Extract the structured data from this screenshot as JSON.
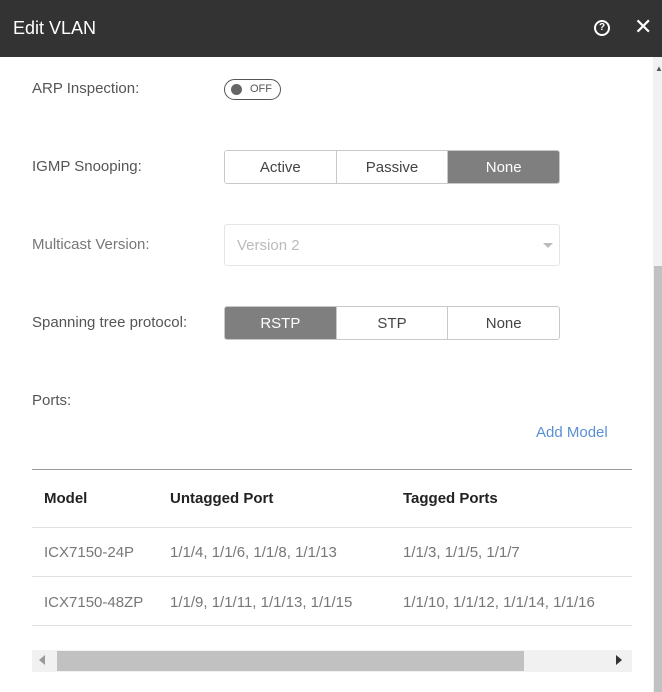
{
  "header": {
    "title": "Edit VLAN",
    "help_icon": "help-circle-icon",
    "help_glyph": "?",
    "close_icon": "close-icon",
    "close_glyph": "✕"
  },
  "form": {
    "arp_label": "ARP Inspection:",
    "arp_toggle_text": "OFF",
    "igmp_label": "IGMP Snooping:",
    "igmp_options": [
      "Active",
      "Passive",
      "None"
    ],
    "igmp_selected": "None",
    "multicast_label": "Multicast Version:",
    "multicast_value": "Version 2",
    "stp_label": "Spanning tree protocol:",
    "stp_options": [
      "RSTP",
      "STP",
      "None"
    ],
    "stp_selected": "RSTP",
    "ports_label": "Ports:",
    "add_model_label": "Add Model"
  },
  "table": {
    "headers": [
      "Model",
      "Untagged Port",
      "Tagged Ports"
    ],
    "rows": [
      [
        "ICX7150-24P",
        "1/1/4, 1/1/6, 1/1/8, 1/1/13",
        "1/1/3, 1/1/5, 1/1/7"
      ],
      [
        "ICX7150-48ZP",
        "1/1/9, 1/1/11, 1/1/13, 1/1/15",
        "1/1/10, 1/1/12, 1/1/14, 1/1/16"
      ]
    ]
  },
  "colors": {
    "titlebar": "#333333",
    "selected_segment": "#7f7f7f",
    "link": "#5b8fd6"
  }
}
